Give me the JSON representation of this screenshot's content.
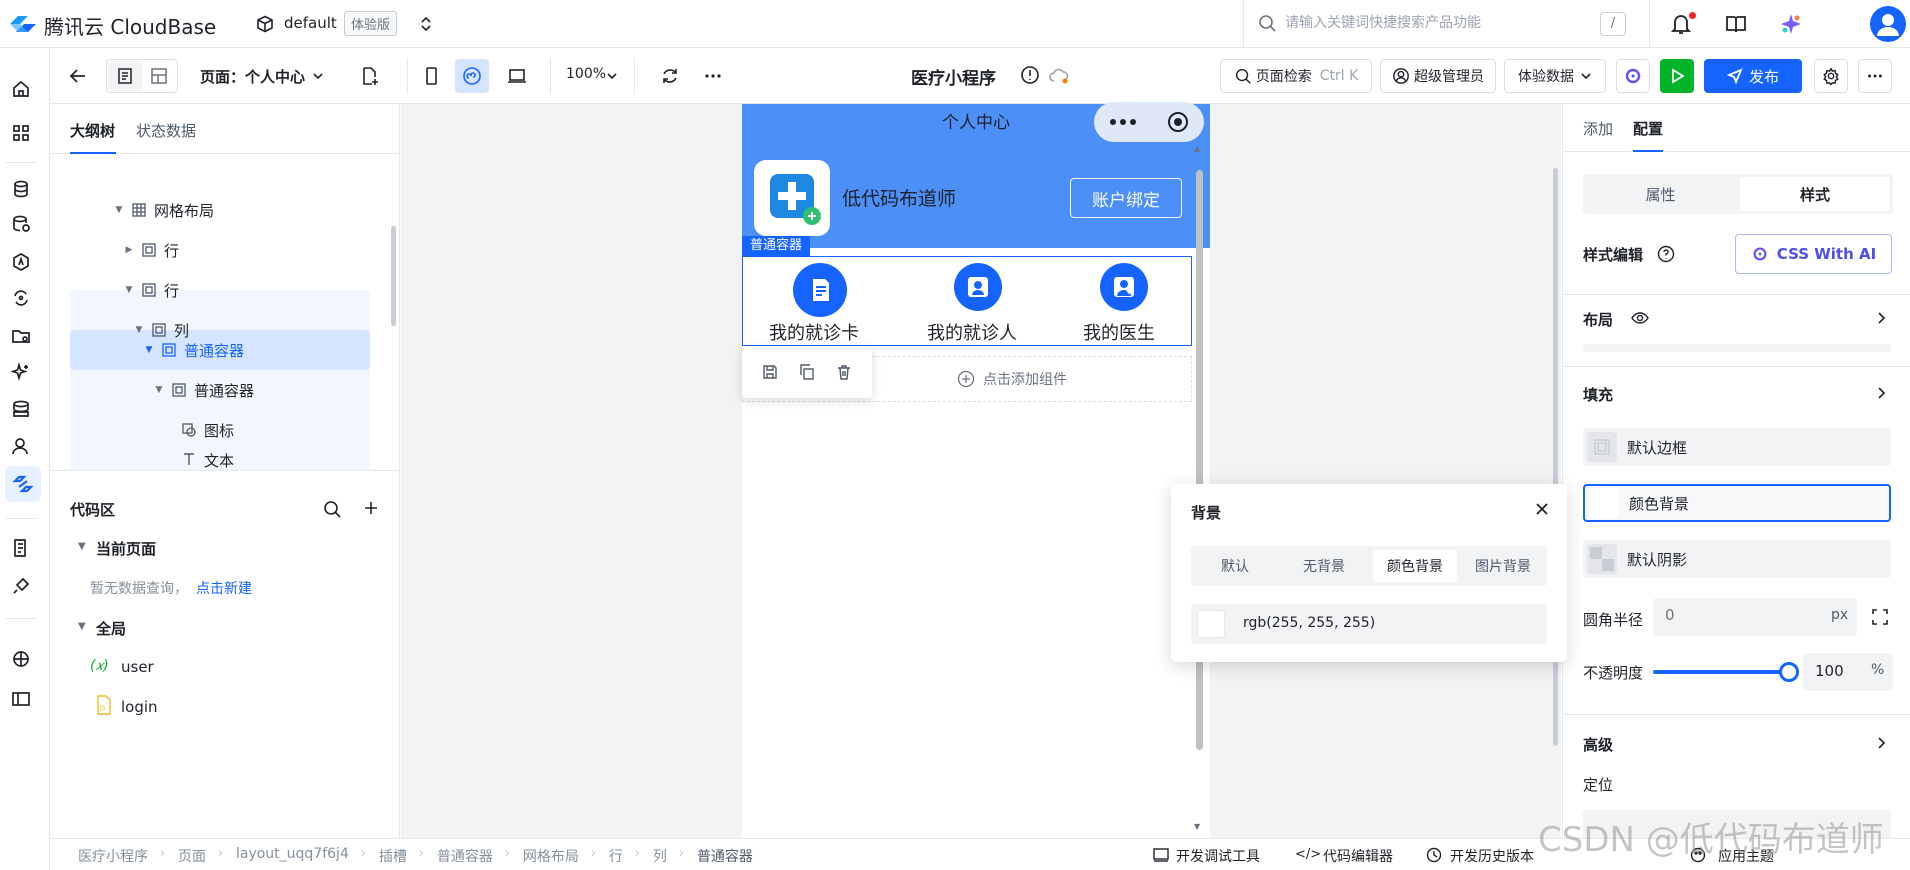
{
  "topbar": {
    "brand": "腾讯云 CloudBase",
    "env_name": "default",
    "env_tag": "体验版",
    "search_placeholder": "请输入关键词快捷搜索产品功能",
    "search_shortcut": "/"
  },
  "toolbar": {
    "page_label": "页面：个人中心",
    "zoom": "100%",
    "app_title": "医疗小程序",
    "page_search": "页面检索",
    "page_search_shortcut": "Ctrl K",
    "admin": "超级管理员",
    "experience_data": "体验数据",
    "publish": "发布"
  },
  "outline": {
    "tabs": [
      "大纲树",
      "状态数据"
    ],
    "tree": [
      {
        "label": "网格布局"
      },
      {
        "label": "行"
      },
      {
        "label": "行"
      },
      {
        "label": "列"
      },
      {
        "label": "普通容器"
      },
      {
        "label": "普通容器"
      },
      {
        "label": "图标"
      },
      {
        "label": "文本"
      }
    ]
  },
  "code": {
    "title": "代码区",
    "current_page": "当前页面",
    "empty_text": "暂无数据查询，",
    "new_link": "点击新建",
    "global": "全局",
    "items": [
      {
        "prefix": "(𝑥)",
        "label": "user"
      },
      {
        "label": "login"
      }
    ]
  },
  "phone": {
    "nav_title": "个人中心",
    "user_name": "低代码布道师",
    "bind_button": "账户绑定",
    "container_tag": "普通容器",
    "grid": [
      {
        "label": "我的就诊卡",
        "icon": "document-icon"
      },
      {
        "label": "我的就诊人",
        "icon": "patient-icon"
      },
      {
        "label": "我的医生",
        "icon": "doctor-icon"
      }
    ],
    "add_component": "点击添加组件"
  },
  "right": {
    "tabs": [
      "添加",
      "配置"
    ],
    "segments": [
      "属性",
      "样式"
    ],
    "style_edit": "样式编辑",
    "css_ai": "CSS With AI",
    "layout": "布局",
    "fill": "填充",
    "fill_items": [
      "默认边框",
      "颜色背景",
      "默认阴影"
    ],
    "radius_label": "圆角半径",
    "radius_placeholder": "0",
    "radius_unit": "px",
    "opacity_label": "不透明度",
    "opacity_value": "100",
    "opacity_unit": "%",
    "opacity_level": 1.0,
    "advanced": "高级",
    "position": "定位"
  },
  "popover": {
    "title": "背景",
    "tabs": [
      "默认",
      "无背景",
      "颜色背景",
      "图片背景"
    ],
    "active_tab": "颜色背景",
    "color_value": "rgb(255, 255, 255)"
  },
  "bottombar": {
    "breadcrumb": [
      "医疗小程序",
      "页面",
      "layout_uqq7f6j4",
      "插槽",
      "普通容器",
      "网格布局",
      "行",
      "列",
      "普通容器"
    ],
    "tools": [
      "开发调试工具",
      "代码编辑器",
      "开发历史版本",
      "应用主题"
    ]
  },
  "watermark": "CSDN @低代码布道师",
  "colors": {
    "accent": "#1664ff",
    "phone_header": "#4b8ff7",
    "run": "#00b42a"
  }
}
